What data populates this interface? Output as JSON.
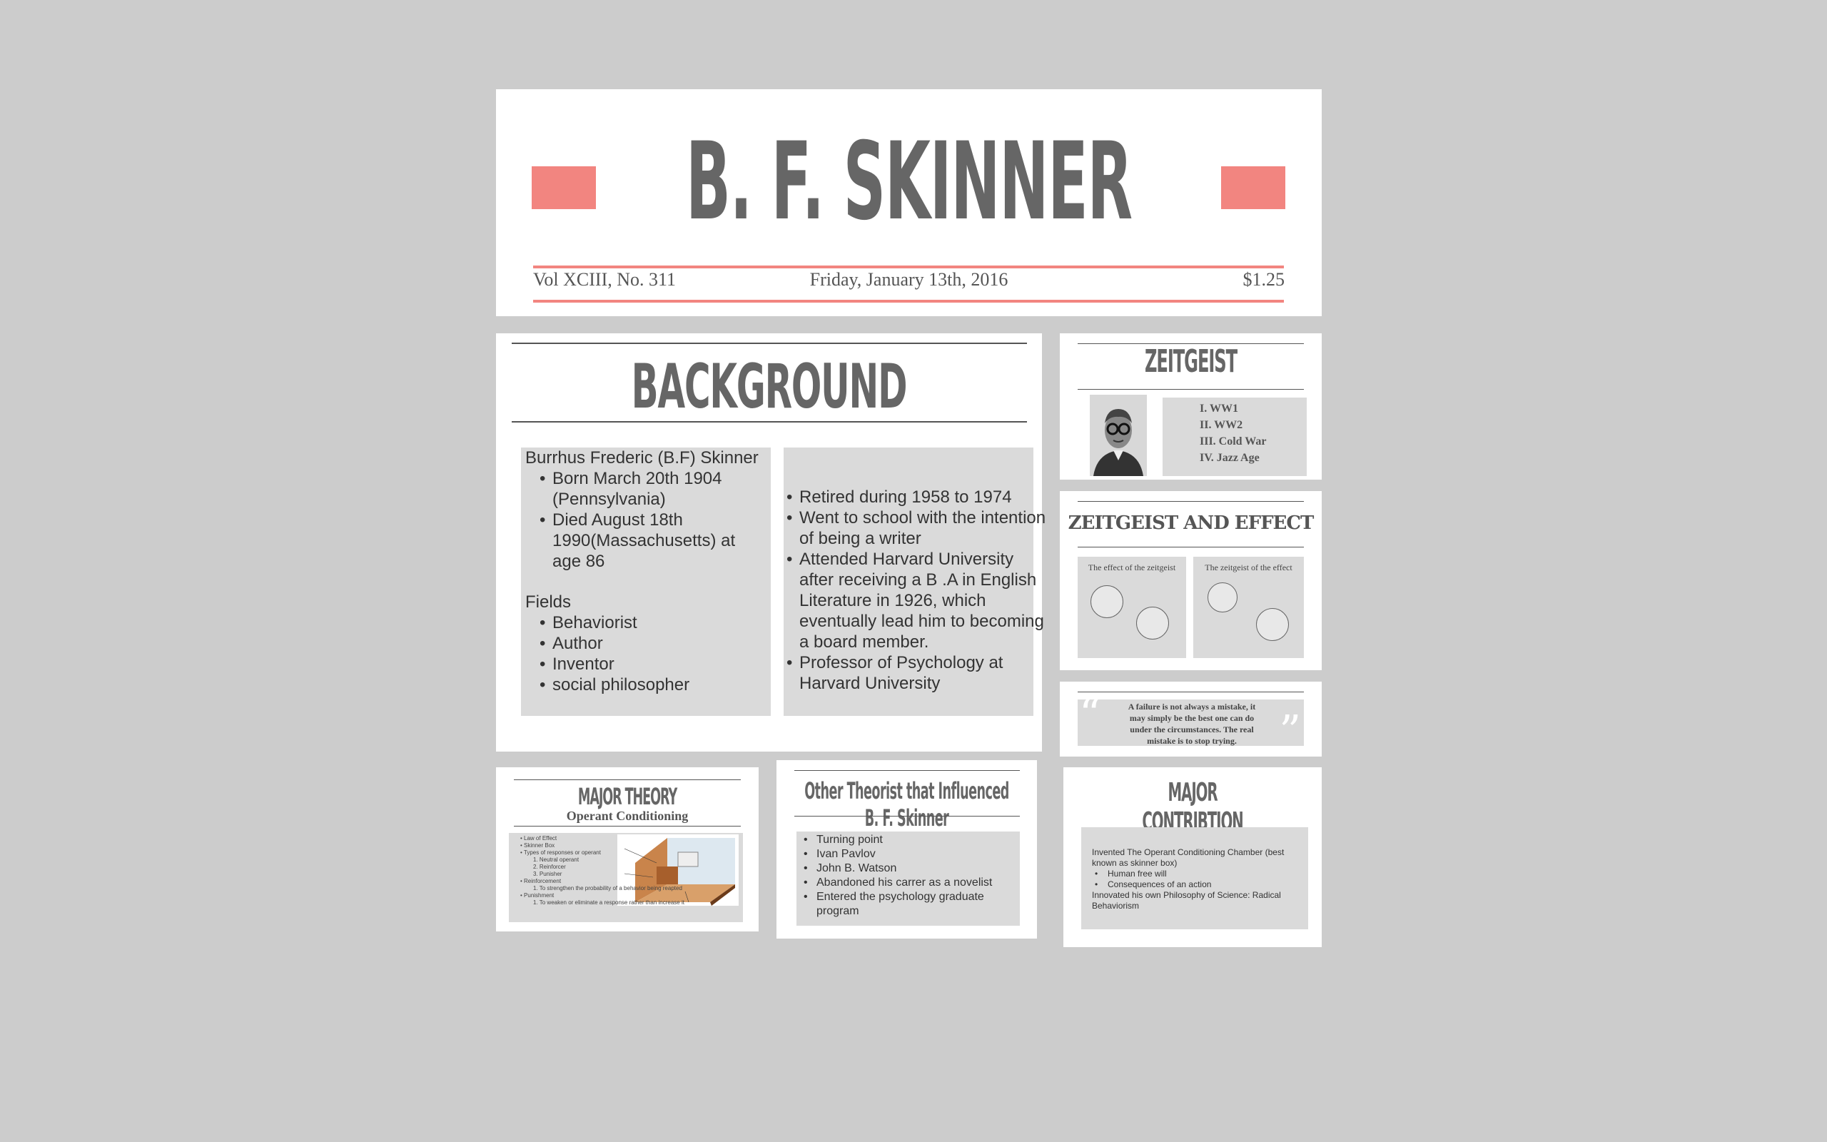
{
  "header": {
    "title": "B. F. SKINNER",
    "volume": "Vol XCIII, No. 311",
    "date": "Friday, January 13th, 2016",
    "price": "$1.25"
  },
  "background": {
    "title": "BACKGROUND",
    "name": "Burrhus Frederic (B.F) Skinner",
    "bio": [
      "Born March 20th 1904 (Pennsylvania)",
      "Died August 18th 1990(Massachusetts) at age 86"
    ],
    "fields_label": "Fields",
    "fields": [
      "Behaviorist",
      "Author",
      "Inventor",
      "social philosopher"
    ],
    "facts": [
      "Retired during 1958 to 1974",
      "Went to school with the intention of being a writer",
      "Attended Harvard University after receiving a B .A in English Literature in 1926, which eventually lead him to becoming a board member.",
      "Professor of Psychology at Harvard University"
    ]
  },
  "zeitgeist": {
    "title": "ZEITGEIST",
    "items": [
      "I. WW1",
      "II. WW2",
      "III. Cold War",
      "IV. Jazz Age"
    ]
  },
  "zeitgeist_effect": {
    "title": "ZEITGEIST AND EFFECT",
    "card1": "The effect of the zeitgeist",
    "card2": "The zeitgeist of the effect"
  },
  "quote": {
    "text": "A failure is not always a mistake, it may simply be the best one can do under the circumstances. The real mistake is to stop trying."
  },
  "major_theory": {
    "title": "MAJOR THEORY",
    "subtitle": "Operant Conditioning",
    "items": [
      "Law of Effect",
      "Skinner Box",
      "Types of responses or operant"
    ],
    "operants": [
      "1. Neutral operant",
      "2. Reinforcer",
      "3. Punisher"
    ],
    "reinforcement": "Reinforcement",
    "reinforcement_sub": "1. To strengthen the probability of a behavior being reapted",
    "punishment": "Punishment",
    "punishment_sub": "1. To weaken or eliminate a response rather than increase it"
  },
  "other_theorist": {
    "title": "Other Theorist that Influenced B. F. Skinner",
    "items": [
      "Turning point",
      "Ivan Pavlov",
      "John B. Watson",
      "Abandoned his carrer as a novelist",
      "Entered the psychology graduate program"
    ]
  },
  "major_contribution": {
    "title": "MAJOR CONTRIBTION",
    "line1": "Invented The Operant Conditioning Chamber (best known as skinner box)",
    "bullets": [
      "Human free will",
      "Consequences of an action"
    ],
    "line2": "Innovated his own Philosophy of Science: Radical Behaviorism"
  },
  "colors": {
    "accent": "#f28580",
    "canvas": "#cccccc",
    "box": "#dadada"
  }
}
